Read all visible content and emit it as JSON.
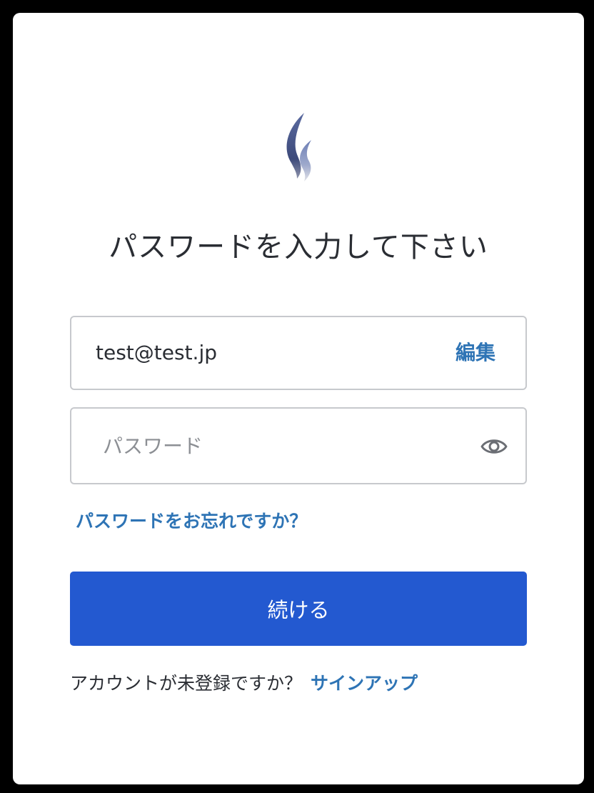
{
  "title": "パスワードを入力して下さい",
  "email": {
    "value": "test@test.jp",
    "edit_label": "編集"
  },
  "password": {
    "placeholder": "パスワード",
    "toggle_icon": "eye-icon"
  },
  "forgot_password_label": "パスワードをお忘れですか？",
  "continue_label": "続ける",
  "signup": {
    "prompt": "アカウントが未登録ですか？",
    "link_label": "サインアップ"
  },
  "colors": {
    "accent": "#2e74b5",
    "button": "#2359d0",
    "logo_gradient_start": "#4a5a8a",
    "logo_gradient_end": "#d7d9de"
  }
}
